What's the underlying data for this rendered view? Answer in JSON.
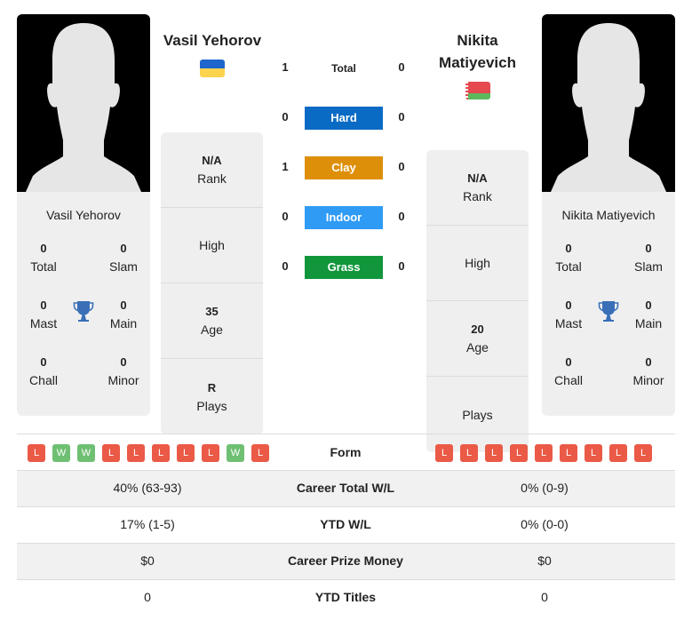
{
  "players": {
    "left": {
      "name": "Vasil Yehorov",
      "flag": "ukraine-flag",
      "flag_colors": [
        "#1f66cc",
        "#fcd34d"
      ],
      "titles": {
        "total": {
          "value": "0",
          "label": "Total"
        },
        "slam": {
          "value": "0",
          "label": "Slam"
        },
        "mast": {
          "value": "0",
          "label": "Mast"
        },
        "main": {
          "value": "0",
          "label": "Main"
        },
        "chall": {
          "value": "0",
          "label": "Chall"
        },
        "minor": {
          "value": "0",
          "label": "Minor"
        }
      },
      "info": {
        "rank": {
          "value": "N/A",
          "label": "Rank"
        },
        "high": {
          "value": "",
          "label": "High"
        },
        "age": {
          "value": "35",
          "label": "Age"
        },
        "plays": {
          "value": "R",
          "label": "Plays"
        }
      }
    },
    "right": {
      "name": "Nikita Matiyevich",
      "name_line1": "Nikita",
      "name_line2": "Matiyevich",
      "flag": "belarus-flag",
      "flag_colors": [
        "#e5484d",
        "#5cb85c"
      ],
      "titles": {
        "total": {
          "value": "0",
          "label": "Total"
        },
        "slam": {
          "value": "0",
          "label": "Slam"
        },
        "mast": {
          "value": "0",
          "label": "Mast"
        },
        "main": {
          "value": "0",
          "label": "Main"
        },
        "chall": {
          "value": "0",
          "label": "Chall"
        },
        "minor": {
          "value": "0",
          "label": "Minor"
        }
      },
      "info": {
        "rank": {
          "value": "N/A",
          "label": "Rank"
        },
        "high": {
          "value": "",
          "label": "High"
        },
        "age": {
          "value": "20",
          "label": "Age"
        },
        "plays": {
          "value": "",
          "label": "Plays"
        }
      }
    }
  },
  "h2h": [
    {
      "label": "Total",
      "left": "1",
      "right": "0",
      "color": ""
    },
    {
      "label": "Hard",
      "left": "0",
      "right": "0",
      "color": "#0a6bc4"
    },
    {
      "label": "Clay",
      "left": "1",
      "right": "0",
      "color": "#de8f09"
    },
    {
      "label": "Indoor",
      "left": "0",
      "right": "0",
      "color": "#2f9bf5"
    },
    {
      "label": "Grass",
      "left": "0",
      "right": "0",
      "color": "#12963c"
    }
  ],
  "form": {
    "label": "Form",
    "left": [
      "L",
      "W",
      "W",
      "L",
      "L",
      "L",
      "L",
      "L",
      "W",
      "L"
    ],
    "right": [
      "L",
      "L",
      "L",
      "L",
      "L",
      "L",
      "L",
      "L",
      "L"
    ]
  },
  "stats": [
    {
      "label": "Career Total W/L",
      "left": "40% (63-93)",
      "right": "0% (0-9)"
    },
    {
      "label": "YTD W/L",
      "left": "17% (1-5)",
      "right": "0% (0-0)"
    },
    {
      "label": "Career Prize Money",
      "left": "$0",
      "right": "$0"
    },
    {
      "label": "YTD Titles",
      "left": "0",
      "right": "0"
    }
  ],
  "colors": {
    "trophy": "#3a6fb8",
    "loss": "#ea5a47",
    "win": "#6fbf73"
  }
}
